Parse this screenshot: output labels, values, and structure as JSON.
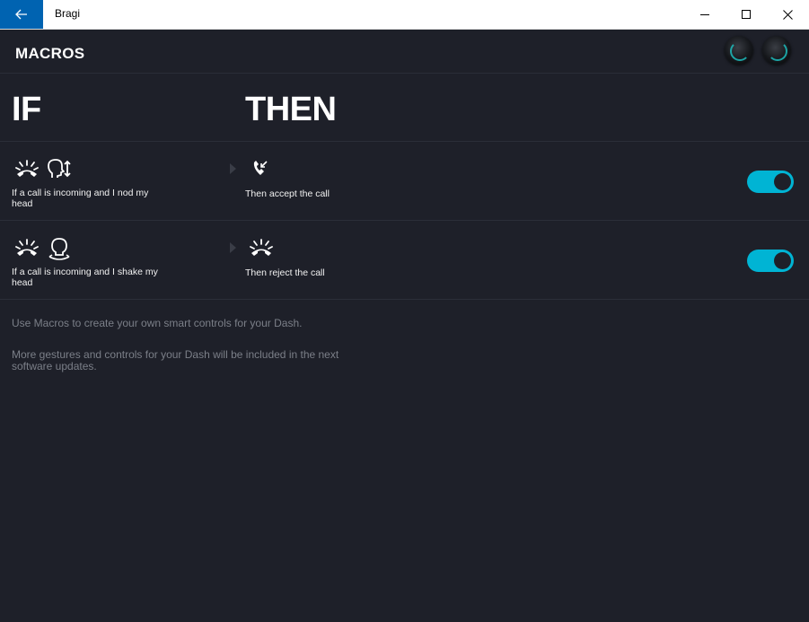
{
  "window": {
    "title": "Bragi",
    "back_icon": "arrow-left-icon",
    "controls": [
      "minimize-icon",
      "maximize-icon",
      "close-icon"
    ],
    "accent": "#0063b1"
  },
  "header": {
    "title": "MACROS",
    "devices": [
      "earbud-left",
      "earbud-right"
    ]
  },
  "columns": {
    "if_label": "IF",
    "then_label": "THEN"
  },
  "macros": [
    {
      "condition_icons": [
        "incoming-call-icon",
        "head-nod-icon"
      ],
      "condition_text": "If a call is incoming and I nod my head",
      "action_icon": "accept-call-icon",
      "action_text": "Then accept the call",
      "enabled": true
    },
    {
      "condition_icons": [
        "incoming-call-icon",
        "head-shake-icon"
      ],
      "condition_text": "If a call is incoming and I shake my head",
      "action_icon": "reject-call-icon",
      "action_text": "Then reject the call",
      "enabled": true
    }
  ],
  "info": {
    "line1": "Use Macros to create your own smart controls for your Dash.",
    "line2": "More gestures and controls for your Dash will be included in the next software updates."
  },
  "colors": {
    "background": "#1e2029",
    "toggle_on": "#00b4d4",
    "text_muted": "#7b7f88"
  }
}
